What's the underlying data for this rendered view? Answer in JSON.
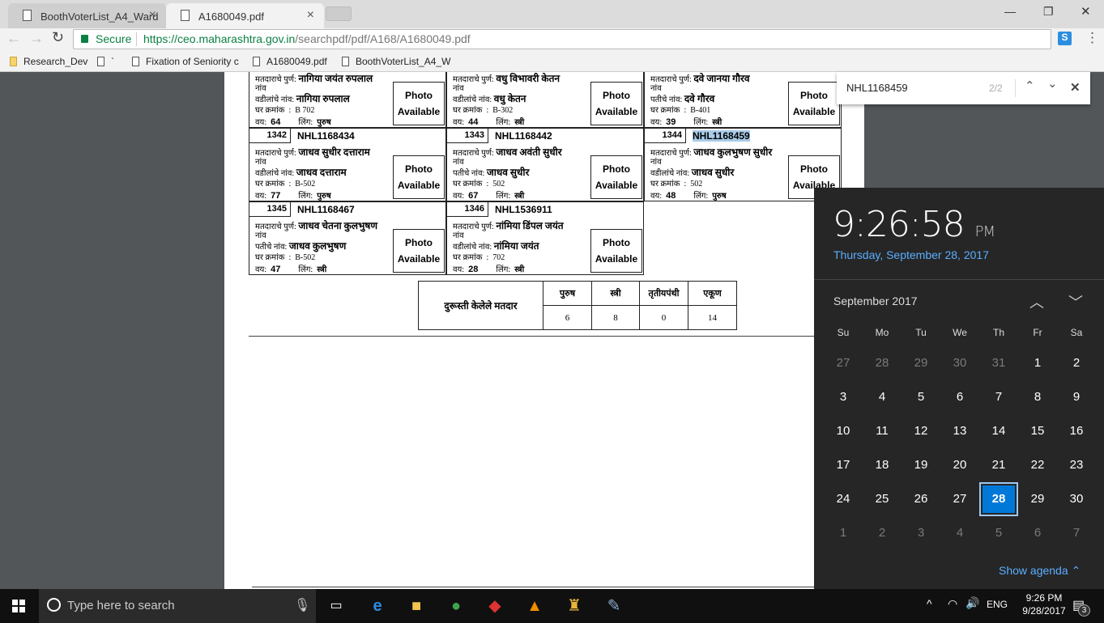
{
  "browser": {
    "tabs": [
      {
        "label": "BoothVoterList_A4_Ward",
        "active": false
      },
      {
        "label": "A1680049.pdf",
        "active": true
      }
    ],
    "secure_label": "Secure",
    "url_host": "https://ceo.maharashtra.gov.in",
    "url_path": "/searchpdf/pdf/A168/A1680049.pdf",
    "bookmarks": [
      {
        "label": "Research_Dev",
        "icon": "folder-icon"
      },
      {
        "label": "`",
        "icon": "page-icon"
      },
      {
        "label": "Fixation of Seniority c",
        "icon": "page-icon"
      },
      {
        "label": "A1680049.pdf",
        "icon": "page-icon"
      },
      {
        "label": "BoothVoterList_A4_W",
        "icon": "page-icon"
      }
    ],
    "window_controls": {
      "minimize": "—",
      "restore": "❐",
      "close": "✕"
    }
  },
  "find_bar": {
    "query": "NHL1168459",
    "count": "2/2"
  },
  "voters": [
    {
      "sn": "",
      "epic": "",
      "name_label": "मतदाराचे पुर्ण",
      "name": "नागिया जयंत रुपलाल",
      "naav": "नांव",
      "rel_label": "वडीलांचे नांव",
      "rel_name": "नागिया रुपलाल",
      "house_label": "घर क्रमांक",
      "house": "B 702",
      "age_label": "वय",
      "age": "64",
      "gender_label": "लिंग",
      "gender": "पुरुष",
      "photo": [
        "Photo",
        "Available"
      ]
    },
    {
      "sn": "",
      "epic": "",
      "name_label": "मतदाराचे पुर्ण",
      "name": "वधु विभावरी केतन",
      "naav": "नांव",
      "rel_label": "वडीलांचे नांव",
      "rel_name": "वधु केतन",
      "house_label": "घर क्रमांक",
      "house": "B-302",
      "age_label": "वय",
      "age": "44",
      "gender_label": "लिंग",
      "gender": "स्त्री",
      "photo": [
        "Photo",
        "Available"
      ]
    },
    {
      "sn": "",
      "epic": "",
      "name_label": "मतदाराचे पुर्ण",
      "name": "दवे जानया गौरव",
      "naav": "नांव",
      "rel_label": "पतीचे नांव",
      "rel_name": "दवे गौरव",
      "house_label": "घर क्रमांक",
      "house": "B-401",
      "age_label": "वय",
      "age": "39",
      "gender_label": "लिंग",
      "gender": "स्त्री",
      "photo": [
        "Photo",
        "Available"
      ]
    },
    {
      "sn": "1342",
      "epic": "NHL1168434",
      "name_label": "मतदाराचे पुर्ण",
      "name": "जाधव सुधीर दत्ताराम",
      "naav": "नांव",
      "rel_label": "वडीलांचे नांव",
      "rel_name": "जाधव दत्ताराम",
      "house_label": "घर क्रमांक",
      "house": "B-502",
      "age_label": "वय",
      "age": "77",
      "gender_label": "लिंग",
      "gender": "पुरुष",
      "photo": [
        "Photo",
        "Available"
      ]
    },
    {
      "sn": "1343",
      "epic": "NHL1168442",
      "name_label": "मतदाराचे पुर्ण",
      "name": "जाधव अवंती सुधीर",
      "naav": "नांव",
      "rel_label": "पतीचे नांव",
      "rel_name": "जाधव सुधीर",
      "house_label": "घर क्रमांक",
      "house": "502",
      "age_label": "वय",
      "age": "67",
      "gender_label": "लिंग",
      "gender": "स्त्री",
      "photo": [
        "Photo",
        "Available"
      ]
    },
    {
      "sn": "1344",
      "epic": "NHL1168459",
      "highlight": true,
      "name_label": "मतदाराचे पुर्ण",
      "name": "जाधव कुलभुषण सुधीर",
      "naav": "नांव",
      "rel_label": "वडीलांचे नांव",
      "rel_name": "जाधव सुधीर",
      "house_label": "घर क्रमांक",
      "house": "502",
      "age_label": "वय",
      "age": "48",
      "gender_label": "लिंग",
      "gender": "पुरुष",
      "photo": [
        "Photo",
        "Available"
      ]
    },
    {
      "sn": "1345",
      "epic": "NHL1168467",
      "name_label": "मतदाराचे पुर्ण",
      "name": "जाधव चेतना कुलभुषण",
      "naav": "नांव",
      "rel_label": "पतीचे नांव",
      "rel_name": "जाधव कुलभुषण",
      "house_label": "घर क्रमांक",
      "house": "B-502",
      "age_label": "वय",
      "age": "47",
      "gender_label": "लिंग",
      "gender": "स्त्री",
      "photo": [
        "Photo",
        "Available"
      ]
    },
    {
      "sn": "1346",
      "epic": "NHL1536911",
      "name_label": "मतदाराचे पुर्ण",
      "name": "नांमिया डिंपल जयंत",
      "naav": "नांव",
      "rel_label": "वडीलांचे नांव",
      "rel_name": "नांमिया जयंत",
      "house_label": "घर क्रमांक",
      "house": "702",
      "age_label": "वय",
      "age": "28",
      "gender_label": "लिंग",
      "gender": "स्त्री",
      "photo": [
        "Photo",
        "Available"
      ]
    }
  ],
  "summary": {
    "row_label": "दुरूस्ती केलेले मतदार",
    "headers": [
      "पुरुष",
      "स्त्री",
      "तृतीयपंथी",
      "एकूण"
    ],
    "values": [
      "6",
      "8",
      "0",
      "14"
    ]
  },
  "clock": {
    "time": "9:26:58",
    "ampm": "PM",
    "date": "Thursday, September 28, 2017"
  },
  "calendar": {
    "month": "September 2017",
    "weekdays": [
      "Su",
      "Mo",
      "Tu",
      "We",
      "Th",
      "Fr",
      "Sa"
    ],
    "days": [
      27,
      28,
      29,
      30,
      31,
      1,
      2,
      3,
      4,
      5,
      6,
      7,
      8,
      9,
      10,
      11,
      12,
      13,
      14,
      15,
      16,
      17,
      18,
      19,
      20,
      21,
      22,
      23,
      24,
      25,
      26,
      27,
      28,
      29,
      30,
      1,
      2,
      3,
      4,
      5,
      6,
      7
    ],
    "selected": 28,
    "show_agenda": "Show agenda"
  },
  "taskbar": {
    "search_placeholder": "Type here to search",
    "lang": "ENG",
    "time": "9:26 PM",
    "date": "9/28/2017",
    "notifications": "3"
  },
  "colors": {
    "accent": "#0078d7",
    "highlight": "#a8cbe8"
  }
}
